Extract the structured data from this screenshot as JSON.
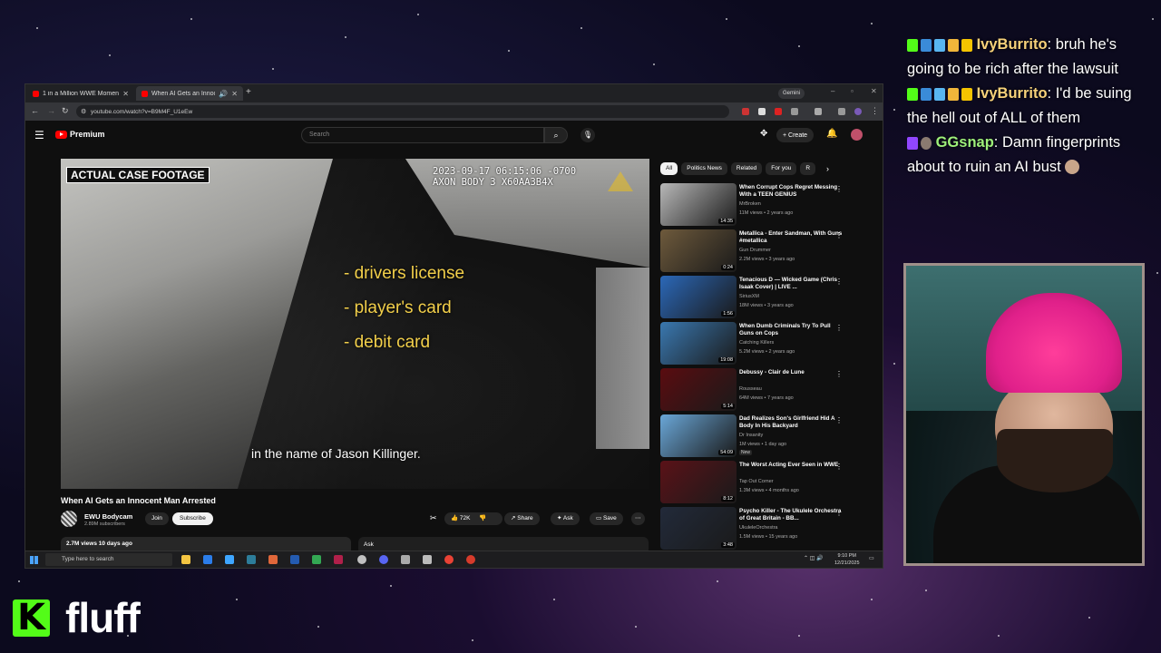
{
  "browser": {
    "tabs": [
      {
        "label": "1 in a Million WWE Moments ·"
      },
      {
        "label": "When AI Gets an Innocent"
      }
    ],
    "gemini_label": "Gemini",
    "url": "youtube.com/watch?v=B9M4F_U1eEw"
  },
  "youtube": {
    "logo_text": "Premium",
    "search_placeholder": "Search",
    "create_label": "Create"
  },
  "video": {
    "badge": "ACTUAL CASE FOOTAGE",
    "timestamp_line1": "2023-09-17 06:15:06 -0700",
    "timestamp_line2": "AXON BODY 3 X60AA3B4X",
    "overlay_items": [
      "- drivers license",
      "- player's card",
      "- debit card"
    ],
    "caption": "in the name of Jason Killinger.",
    "title": "When AI Gets an Innocent Man Arrested",
    "channel_name": "EWU Bodycam",
    "subscribers": "2.89M subscribers",
    "join_label": "Join",
    "subscribe_label": "Subscribe",
    "likes": "72K",
    "share_label": "Share",
    "ask_label": "Ask",
    "save_label": "Save",
    "views_date": "2.7M views  10 days ago",
    "ask_box_label": "Ask"
  },
  "sidebar": {
    "chips": [
      "All",
      "Politics News",
      "Related",
      "For you",
      "R"
    ],
    "recommendations": [
      {
        "title": "When Corrupt Cops Regret Messing With a TEEN GENIUS",
        "channel": "MrBroken",
        "meta": "11M views • 2 years ago",
        "duration": "14:35",
        "badge": "",
        "thumb": "#b8b8b8"
      },
      {
        "title": "Metallica - Enter Sandman, With Guns #metallica",
        "channel": "Gun Drummer",
        "meta": "2.2M views • 3 years ago",
        "duration": "0:24",
        "badge": "",
        "thumb": "#6e5a3c"
      },
      {
        "title": "Tenacious D — Wicked Game (Chris Isaak Cover) | LIVE ...",
        "channel": "SiriusXM",
        "meta": "18M views • 3 years ago",
        "duration": "1:56",
        "badge": "",
        "thumb": "#2b68b8"
      },
      {
        "title": "When Dumb Criminals Try To Pull Guns on Cops",
        "channel": "Catching Killers",
        "meta": "5.2M views • 2 years ago",
        "duration": "19:08",
        "badge": "",
        "thumb": "#3a78b0"
      },
      {
        "title": "Debussy - Clair de Lune",
        "channel": "Rousseau",
        "meta": "64M views • 7 years ago",
        "duration": "5:14",
        "badge": "",
        "thumb": "#5a0c10"
      },
      {
        "title": "Dad Realizes Son's Girlfriend Hid A Body In His Backyard",
        "channel": "Dr Insanity",
        "meta": "1M views • 1 day ago",
        "duration": "54:09",
        "badge": "New",
        "thumb": "#6aa7d8"
      },
      {
        "title": "The Worst Acting Ever Seen in WWE",
        "channel": "Tap Out Corner",
        "meta": "1.3M views • 4 months ago",
        "duration": "8:12",
        "badge": "",
        "thumb": "#5a1218"
      },
      {
        "title": "Psycho Killer - The Ukulele Orchestra of Great Britain - BB...",
        "channel": "UkuleleOrchestra",
        "meta": "1.5M views • 15 years ago",
        "duration": "3:48",
        "badge": "",
        "thumb": "#222a3a"
      }
    ]
  },
  "taskbar": {
    "search_placeholder": "Type here to search",
    "time": "9:10 PM",
    "date": "12/21/2025"
  },
  "chat": {
    "messages": [
      {
        "user": "IvyBurrito",
        "text": ": bruh he's going to be rich after the lawsuit",
        "user_color": "gold"
      },
      {
        "user": "IvyBurrito",
        "text": ": I'd be suing the hell out of ALL of them",
        "user_color": "gold"
      },
      {
        "user": "GGsnap",
        "text": ": Damn fingerprints about to ruin an AI bust",
        "user_color": "green"
      }
    ]
  },
  "brand": {
    "mark": "K",
    "name": "fluff"
  },
  "colors": {
    "kick_green": "#53fc18",
    "youtube_red": "#ff0000",
    "overlay_yellow": "#f2cf4a"
  }
}
